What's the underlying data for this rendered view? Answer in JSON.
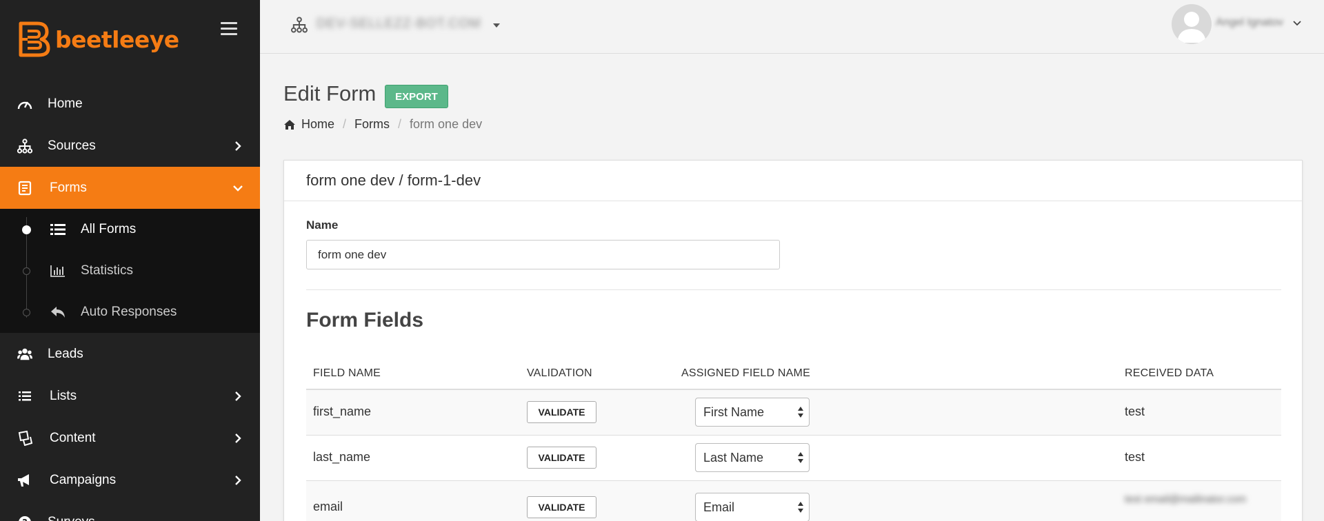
{
  "brand": {
    "name": "beetleeye",
    "color": "#f57c14"
  },
  "sidebar": {
    "items": [
      {
        "label": "Home",
        "icon": "gauge-icon"
      },
      {
        "label": "Sources",
        "icon": "sitemap-icon"
      },
      {
        "label": "Forms",
        "icon": "form-icon"
      },
      {
        "label": "Leads",
        "icon": "users-icon"
      },
      {
        "label": "Lists",
        "icon": "list-icon"
      },
      {
        "label": "Content",
        "icon": "content-icon"
      },
      {
        "label": "Campaigns",
        "icon": "megaphone-icon"
      },
      {
        "label": "Surveys",
        "icon": "question-icon"
      }
    ],
    "forms_sub": [
      {
        "label": "All Forms",
        "icon": "list-icon"
      },
      {
        "label": "Statistics",
        "icon": "bar-chart-icon"
      },
      {
        "label": "Auto Responses",
        "icon": "reply-icon"
      }
    ]
  },
  "topbar": {
    "org_name": "DEV-SELLEZZ-BOT.COM",
    "user_name": "Angel Ignatov"
  },
  "page": {
    "title": "Edit Form",
    "export_label": "EXPORT",
    "breadcrumb": [
      "Home",
      "Forms",
      "form one dev"
    ]
  },
  "panel": {
    "title": "form one dev / form-1-dev",
    "name_label": "Name",
    "name_value": "form one dev",
    "section_title": "Form Fields",
    "columns": [
      "FIELD NAME",
      "VALIDATION",
      "ASSIGNED FIELD NAME",
      "RECEIVED DATA"
    ],
    "validate_label": "VALIDATE",
    "rows": [
      {
        "field": "first_name",
        "assigned": "First Name",
        "received": "test"
      },
      {
        "field": "last_name",
        "assigned": "Last Name",
        "received": "test"
      },
      {
        "field": "email",
        "assigned": "Email",
        "received": "test email@mailinator.com"
      }
    ]
  },
  "colors": {
    "sidebar_bg": "#222222",
    "active_bg": "#f57c14",
    "export_green": "#5cb88a"
  }
}
